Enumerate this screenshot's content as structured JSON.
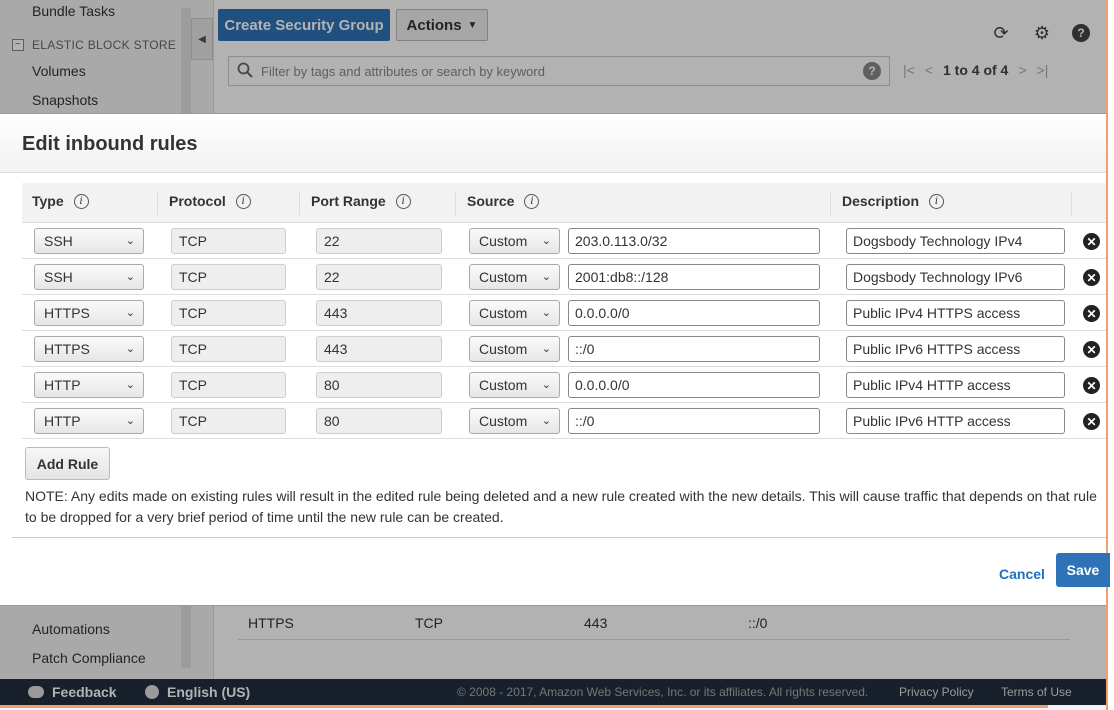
{
  "background": {
    "sidebar": {
      "bundle_tasks": "Bundle Tasks",
      "section_ebs": "ELASTIC BLOCK STORE",
      "volumes": "Volumes",
      "snapshots": "Snapshots",
      "automations": "Automations",
      "patch_compliance": "Patch Compliance"
    },
    "toolbar": {
      "create_label": "Create Security Group",
      "actions_label": "Actions"
    },
    "search": {
      "placeholder": "Filter by tags and attributes or search by keyword"
    },
    "pager": {
      "count": "1 to 4 of 4"
    },
    "visible_row": {
      "type": "HTTPS",
      "protocol": "TCP",
      "port": "443",
      "source": "::/0"
    },
    "footer": {
      "feedback": "Feedback",
      "language": "English (US)",
      "copyright": "© 2008 - 2017, Amazon Web Services, Inc. or its affiliates. All rights reserved.",
      "privacy": "Privacy Policy",
      "terms": "Terms of Use"
    }
  },
  "modal": {
    "title": "Edit inbound rules",
    "columns": {
      "type": "Type",
      "protocol": "Protocol",
      "port_range": "Port Range",
      "source": "Source",
      "description": "Description"
    },
    "rules": [
      {
        "type": "SSH",
        "protocol": "TCP",
        "port": "22",
        "source_mode": "Custom",
        "source": "203.0.113.0/32",
        "description": "Dogsbody Technology IPv4"
      },
      {
        "type": "SSH",
        "protocol": "TCP",
        "port": "22",
        "source_mode": "Custom",
        "source": "2001:db8::/128",
        "description": "Dogsbody Technology IPv6"
      },
      {
        "type": "HTTPS",
        "protocol": "TCP",
        "port": "443",
        "source_mode": "Custom",
        "source": "0.0.0.0/0",
        "description": "Public IPv4 HTTPS access"
      },
      {
        "type": "HTTPS",
        "protocol": "TCP",
        "port": "443",
        "source_mode": "Custom",
        "source": "::/0",
        "description": "Public IPv6 HTTPS access"
      },
      {
        "type": "HTTP",
        "protocol": "TCP",
        "port": "80",
        "source_mode": "Custom",
        "source": "0.0.0.0/0",
        "description": "Public IPv4 HTTP access"
      },
      {
        "type": "HTTP",
        "protocol": "TCP",
        "port": "80",
        "source_mode": "Custom",
        "source": "::/0",
        "description": "Public IPv6 HTTP access"
      }
    ],
    "add_rule_label": "Add Rule",
    "note": "NOTE: Any edits made on existing rules will result in the edited rule being deleted and a new rule created with the new details. This will cause traffic that depends on that rule to be dropped for a very brief period of time until the new rule can be created.",
    "cancel_label": "Cancel",
    "save_label": "Save"
  },
  "colors": {
    "primary": "#2e73b8",
    "link": "#1e70bf",
    "footer": "#232f3e",
    "accent_edge": "#f0a070"
  }
}
